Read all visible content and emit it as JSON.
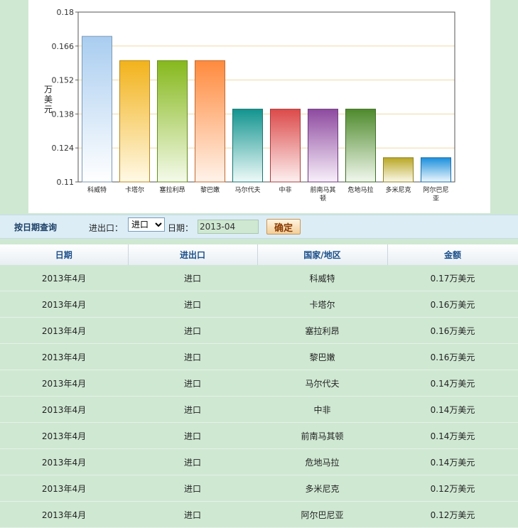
{
  "chart_data": {
    "type": "bar",
    "categories": [
      "科威特",
      "卡塔尔",
      "塞拉利昂",
      "黎巴嫩",
      "马尔代夫",
      "中非",
      "前南马其顿",
      "危地马拉",
      "多米尼克",
      "阿尔巴尼亚"
    ],
    "values": [
      0.17,
      0.16,
      0.16,
      0.16,
      0.14,
      0.14,
      0.14,
      0.14,
      0.12,
      0.12
    ],
    "ylabel": "万美元",
    "ylim": [
      0.11,
      0.18
    ],
    "yticks": [
      "0.18",
      "0.166",
      "0.152",
      "0.138",
      "0.124",
      "0.11"
    ],
    "grid": true,
    "colors": [
      {
        "top": "#a9cdf0",
        "bottom": "#ffffff",
        "stroke": "#7c9ab5"
      },
      {
        "top": "#f2b21a",
        "bottom": "#fff9e6",
        "stroke": "#b88a20"
      },
      {
        "top": "#86b81c",
        "bottom": "#f4faea",
        "stroke": "#6a8d22"
      },
      {
        "top": "#ff8a3d",
        "bottom": "#fff3ea",
        "stroke": "#c2692f"
      },
      {
        "top": "#12948f",
        "bottom": "#effaf9",
        "stroke": "#177571"
      },
      {
        "top": "#dc4a4a",
        "bottom": "#fdf0f0",
        "stroke": "#a83c3c"
      },
      {
        "top": "#8e4aa0",
        "bottom": "#f8f0fa",
        "stroke": "#6e3a7e"
      },
      {
        "top": "#4e8a2c",
        "bottom": "#f2f8ee",
        "stroke": "#3f6d26"
      },
      {
        "top": "#b9a726",
        "bottom": "#fbf9ea",
        "stroke": "#8f821e"
      },
      {
        "top": "#1b8fdc",
        "bottom": "#eef7fd",
        "stroke": "#1a6ea8"
      }
    ],
    "gridColor": "#f0d9a6"
  },
  "query": {
    "title": "按日期查询",
    "io_label": "进出口：",
    "io_value": "进口",
    "date_label": "日期：",
    "date_value": "2013-04",
    "submit_label": "确定"
  },
  "table": {
    "headers": [
      "日期",
      "进出口",
      "国家/地区",
      "金额"
    ],
    "rows": [
      [
        "2013年4月",
        "进口",
        "科威特",
        "0.17万美元"
      ],
      [
        "2013年4月",
        "进口",
        "卡塔尔",
        "0.16万美元"
      ],
      [
        "2013年4月",
        "进口",
        "塞拉利昂",
        "0.16万美元"
      ],
      [
        "2013年4月",
        "进口",
        "黎巴嫩",
        "0.16万美元"
      ],
      [
        "2013年4月",
        "进口",
        "马尔代夫",
        "0.14万美元"
      ],
      [
        "2013年4月",
        "进口",
        "中非",
        "0.14万美元"
      ],
      [
        "2013年4月",
        "进口",
        "前南马其顿",
        "0.14万美元"
      ],
      [
        "2013年4月",
        "进口",
        "危地马拉",
        "0.14万美元"
      ],
      [
        "2013年4月",
        "进口",
        "多米尼克",
        "0.12万美元"
      ],
      [
        "2013年4月",
        "进口",
        "阿尔巴尼亚",
        "0.12万美元"
      ]
    ]
  }
}
